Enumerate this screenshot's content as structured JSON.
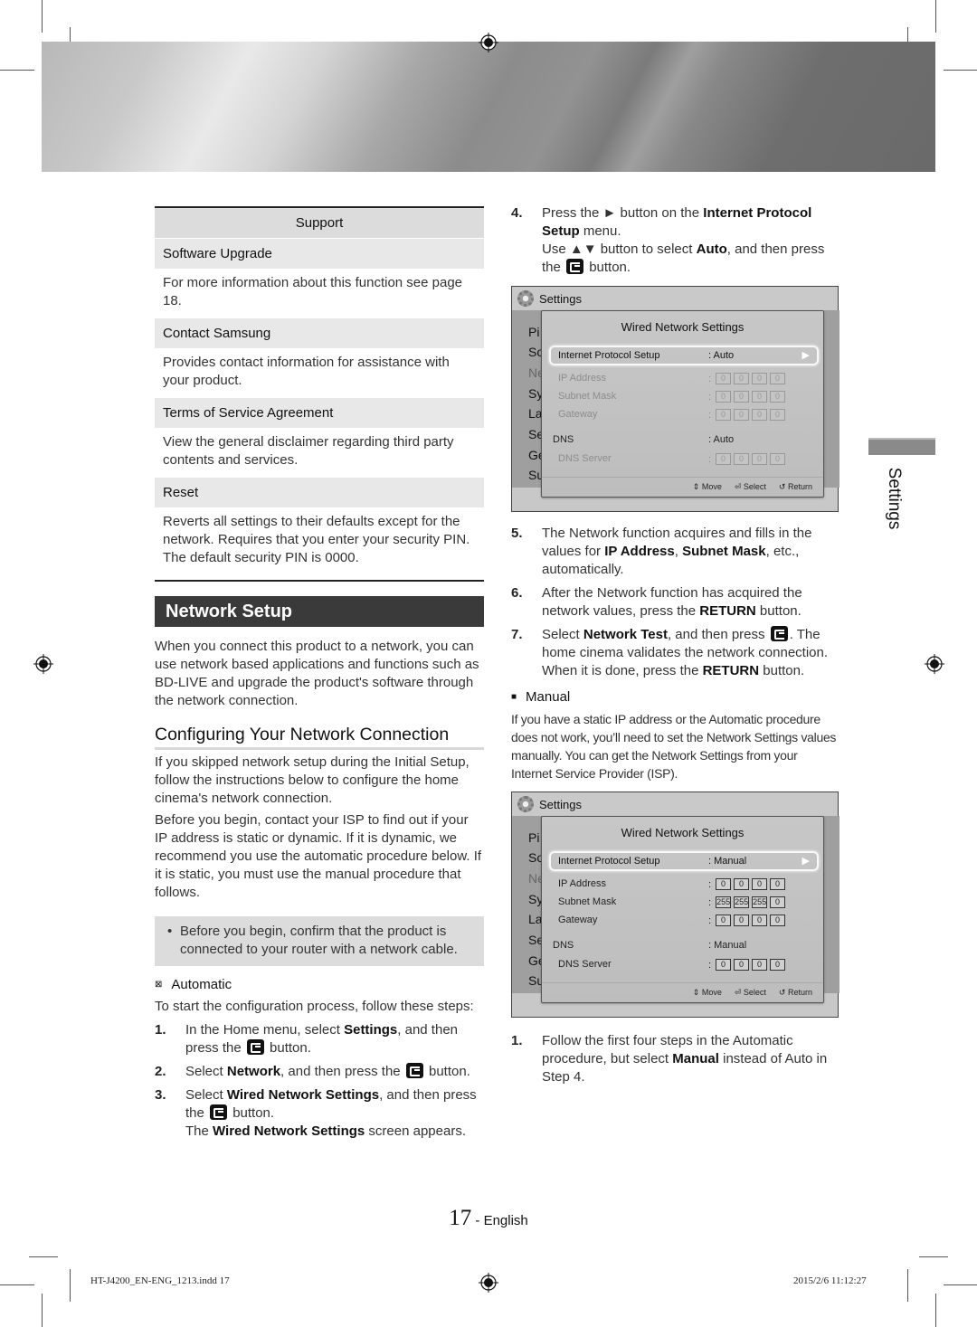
{
  "support_table": {
    "header": "Support",
    "rows": [
      {
        "title": "Software Upgrade",
        "desc": "For more information about this function see page 18."
      },
      {
        "title": "Contact Samsung",
        "desc": "Provides contact information for assistance with your product."
      },
      {
        "title": "Terms of Service Agreement",
        "desc": "View the general disclaimer regarding third party contents and services."
      },
      {
        "title": "Reset",
        "desc": "Reverts all settings to their defaults except for the network. Requires that you enter your security PIN. The default security PIN is 0000."
      }
    ]
  },
  "network_setup": {
    "title": "Network Setup",
    "intro": "When you connect this product to a network, you can use network based applications and functions such as BD-LIVE and upgrade the product's software through the network connection.",
    "configuring": {
      "title": "Configuring Your Network Connection",
      "para1": "If you skipped network setup during the Initial Setup, follow the instructions below to configure the home cinema's network connection.",
      "para2": "Before you begin, contact your ISP to find out if your IP address is static or dynamic. If it is dynamic, we recommend you use the automatic procedure below. If it is static, you must use the manual procedure that follows.",
      "note": "Before you begin, confirm that the product is connected to your router with a network cable."
    },
    "automatic": {
      "title": "Automatic",
      "intro": "To start the configuration process, follow these steps:",
      "steps": [
        {
          "num": "1.",
          "a": "In the Home menu, select ",
          "b": "Settings",
          "c": ", and then press the ",
          "d": " button."
        },
        {
          "num": "2.",
          "a": "Select ",
          "b": "Network",
          "c": ", and then press the ",
          "d": " button."
        },
        {
          "num": "3.",
          "a": "Select ",
          "b": "Wired Network Settings",
          "c": ", and then press the ",
          "d": " button.",
          "e": "The ",
          "f": "Wired Network Settings",
          "g": " screen appears."
        },
        {
          "num": "4.",
          "a": "Press the ► button on the ",
          "b": "Internet Protocol Setup",
          "c": " menu.",
          "d": "Use ▲▼ button to select ",
          "e": "Auto",
          "f": ", and then press the ",
          "g": " button."
        },
        {
          "num": "5.",
          "a": "The Network function acquires and fills in the values for ",
          "b": "IP Address",
          "c": ", ",
          "d": "Subnet Mask",
          "e": ", etc., automatically."
        },
        {
          "num": "6.",
          "a": "After the Network function has acquired the network values, press the ",
          "b": "RETURN",
          "c": " button."
        },
        {
          "num": "7.",
          "a": "Select ",
          "b": "Network Test",
          "c": ", and then press ",
          "d": ". The home cinema validates the network connection. When it is done, press the ",
          "e": "RETURN",
          "f": " button."
        }
      ]
    },
    "manual": {
      "title": "Manual",
      "intro": "If you have a static IP address or the Automatic procedure does not work, you’ll need to set the Network Settings values manually. You can get the Network Settings from your Internet Service Provider (ISP).",
      "steps": [
        {
          "num": "1.",
          "a": "Follow the first four steps in the Automatic procedure, but select ",
          "b": "Manual",
          "c": " instead of Auto in Step 4."
        }
      ]
    }
  },
  "screens": [
    {
      "header": "Settings",
      "menu": [
        "Pi",
        "So",
        "Ne",
        "Sy",
        "La",
        "Se",
        "Ge",
        "Su"
      ],
      "popup_title": "Wired Network Settings",
      "ip_setup_label": "Internet Protocol Setup",
      "ip_setup_value": ": Auto",
      "fields": [
        {
          "label": "IP Address",
          "values": [
            "0",
            "0",
            "0",
            "0"
          ]
        },
        {
          "label": "Subnet Mask",
          "values": [
            "0",
            "0",
            "0",
            "0"
          ]
        },
        {
          "label": "Gateway",
          "values": [
            "0",
            "0",
            "0",
            "0"
          ]
        }
      ],
      "dns_label": "DNS",
      "dns_value": ": Auto",
      "dns_server": {
        "label": "DNS Server",
        "values": [
          "0",
          "0",
          "0",
          "0"
        ]
      },
      "footer": {
        "move": "Move",
        "select": "Select",
        "return": "Return"
      }
    },
    {
      "header": "Settings",
      "menu": [
        "Pi",
        "So",
        "Ne",
        "Sy",
        "La",
        "Se",
        "Ge",
        "Su"
      ],
      "popup_title": "Wired Network Settings",
      "ip_setup_label": "Internet Protocol Setup",
      "ip_setup_value": ": Manual",
      "fields": [
        {
          "label": "IP Address",
          "values": [
            "0",
            "0",
            "0",
            "0"
          ]
        },
        {
          "label": "Subnet Mask",
          "values": [
            "255",
            "255",
            "255",
            "0"
          ]
        },
        {
          "label": "Gateway",
          "values": [
            "0",
            "0",
            "0",
            "0"
          ]
        }
      ],
      "dns_label": "DNS",
      "dns_value": ": Manual",
      "dns_server": {
        "label": "DNS Server",
        "values": [
          "0",
          "0",
          "0",
          "0"
        ]
      },
      "footer": {
        "move": "Move",
        "select": "Select",
        "return": "Return"
      }
    }
  ],
  "side_tab": "Settings",
  "footer": {
    "page_number": "17",
    "language": " - English",
    "slug_left": "HT-J4200_EN-ENG_1213.indd   17",
    "slug_right": "2015/2/6   11:12:27"
  }
}
